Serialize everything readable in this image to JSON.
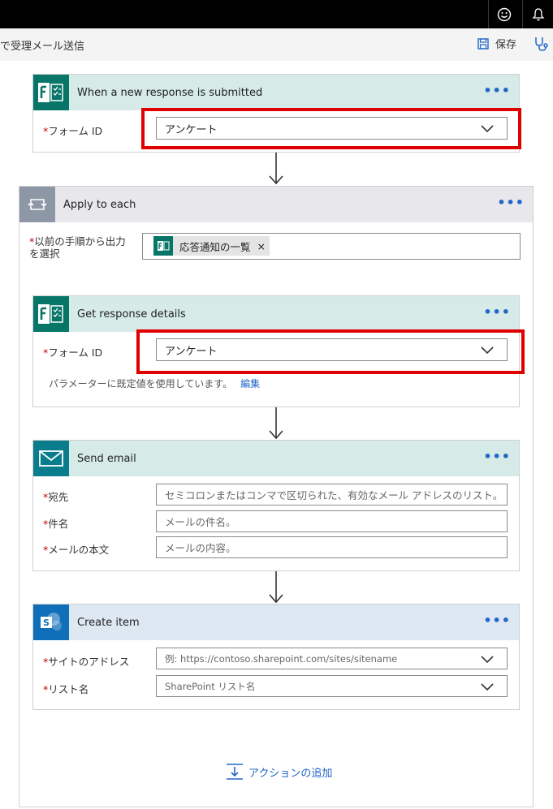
{
  "topbar": {
    "feedback_icon": "smiley-icon",
    "notif_icon": "bell-icon"
  },
  "cmdbar": {
    "flow_title": "で受理メール送信",
    "save_label": "保存"
  },
  "trigger": {
    "title": "When a new response is submitted",
    "form_id_label": "フォーム ID",
    "form_id_value": "アンケート"
  },
  "apply_each": {
    "title": "Apply to each",
    "output_label_line1": "以前の手順から出力",
    "output_label_line2": "を選択",
    "token_label": "応答通知の一覧",
    "token_remove": "×"
  },
  "get_details": {
    "title": "Get response details",
    "form_id_label": "フォーム ID",
    "form_id_value": "アンケート",
    "hint": "パラメーターに既定値を使用しています。",
    "edit_link": "編集"
  },
  "send_email": {
    "title": "Send email",
    "to_label": "宛先",
    "to_placeholder": "セミコロンまたはコンマで区切られた、有効なメール アドレスのリスト。",
    "subject_label": "件名",
    "subject_placeholder": "メールの件名。",
    "body_label": "メールの本文",
    "body_placeholder": "メールの内容。"
  },
  "create_item": {
    "title": "Create item",
    "site_label": "サイトのアドレス",
    "site_placeholder": "例: https://contoso.sharepoint.com/sites/sitename",
    "list_label": "リスト名",
    "list_placeholder": "SharePoint リスト名"
  },
  "add_action_label": "アクションの追加",
  "required_mark": "*",
  "more_label": "•••",
  "colors": {
    "forms": "#077568",
    "loop": "#8d97a5",
    "outlook": "#0a7d8c",
    "sharepoint": "#0f6fb8",
    "link": "#2266c8",
    "highlight": "#e00000"
  }
}
